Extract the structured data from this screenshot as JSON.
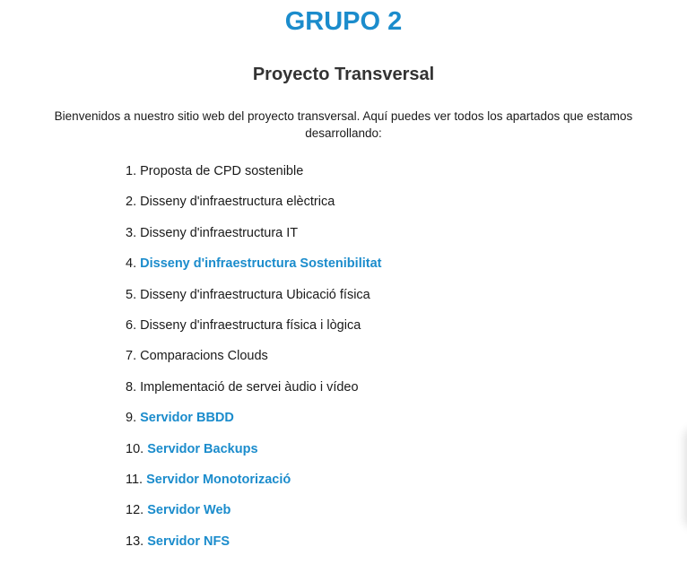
{
  "header": {
    "group_title": "GRUPO 2",
    "subtitle": "Proyecto Transversal"
  },
  "intro": {
    "line1": "Bienvenidos a nuestro sitio web del proyecto transversal. Aquí puedes ver todos los apartados que estamos",
    "line2": "desarrollando:"
  },
  "topics": [
    {
      "num": "1.",
      "label": "Proposta de CPD sostenible",
      "link": false
    },
    {
      "num": "2.",
      "label": "Disseny d'infraestructura elèctrica",
      "link": false
    },
    {
      "num": "3.",
      "label": "Disseny d'infraestructura IT",
      "link": false
    },
    {
      "num": "4.",
      "label": "Disseny d'infraestructura Sostenibilitat",
      "link": true
    },
    {
      "num": "5.",
      "label": "Disseny d'infraestructura Ubicació física",
      "link": false
    },
    {
      "num": "6.",
      "label": "Disseny d'infraestructura física i lògica",
      "link": false
    },
    {
      "num": "7.",
      "label": "Comparacions Clouds",
      "link": false
    },
    {
      "num": "8.",
      "label": "Implementació de servei àudio i vídeo",
      "link": false
    },
    {
      "num": "9.",
      "label": "Servidor BBDD",
      "link": true
    },
    {
      "num": "10.",
      "label": "Servidor Backups",
      "link": true
    },
    {
      "num": "11.",
      "label": "Servidor Monotorizació",
      "link": true
    },
    {
      "num": "12.",
      "label": "Servidor Web",
      "link": true
    },
    {
      "num": "13.",
      "label": "Servidor NFS",
      "link": true
    }
  ],
  "colors": {
    "accent": "#1b8ccc",
    "heading": "#333333",
    "text": "#1a1a1a"
  }
}
